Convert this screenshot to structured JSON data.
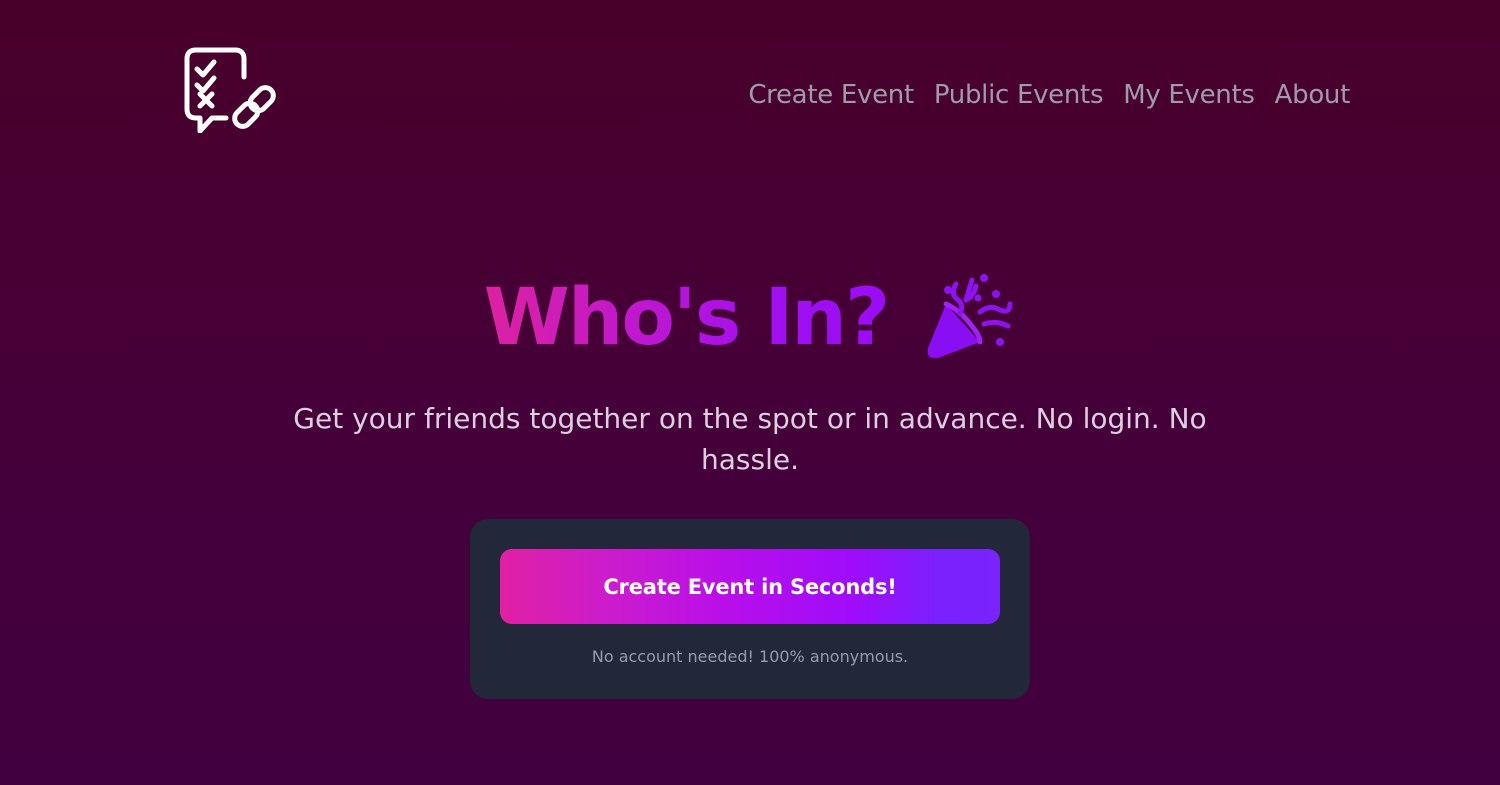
{
  "header": {
    "logo_icon": "checklist-chat-link-icon",
    "nav": [
      {
        "label": "Create Event"
      },
      {
        "label": "Public Events"
      },
      {
        "label": "My Events"
      },
      {
        "label": "About"
      }
    ]
  },
  "hero": {
    "title": "Who's In?",
    "title_icon": "party-popper-icon",
    "subtitle": "Get your friends together on the spot or in advance. No login. No hassle."
  },
  "cta_card": {
    "button_label": "Create Event in Seconds!",
    "note": "No account needed! 100% anonymous."
  },
  "colors": {
    "background_top": "#48002a",
    "background_bottom": "#410040",
    "accent_pink": "#e021a4",
    "accent_purple": "#7a23fc",
    "card_bg": "#22283a",
    "nav_text": "#a09aab"
  }
}
